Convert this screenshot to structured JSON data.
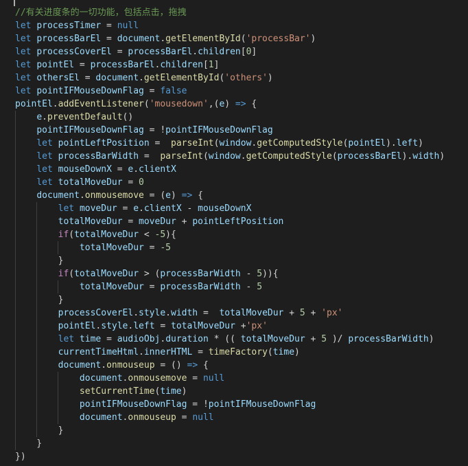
{
  "editor": {
    "theme": "dark",
    "lines": [
      [
        {
          "t": "//有关进度条的一切功能，包括点击，拖拽",
          "c": "cmt"
        }
      ],
      [
        {
          "t": "let ",
          "c": "kw"
        },
        {
          "t": "processTimer",
          "c": "var"
        },
        {
          "t": " = ",
          "c": "op"
        },
        {
          "t": "null",
          "c": "kw"
        }
      ],
      [
        {
          "t": "let ",
          "c": "kw"
        },
        {
          "t": "processBarEl",
          "c": "var"
        },
        {
          "t": " = ",
          "c": "op"
        },
        {
          "t": "document",
          "c": "var"
        },
        {
          "t": ".",
          "c": "op"
        },
        {
          "t": "getElementById",
          "c": "fn"
        },
        {
          "t": "(",
          "c": "op"
        },
        {
          "t": "'processBar'",
          "c": "str"
        },
        {
          "t": ")",
          "c": "op"
        }
      ],
      [
        {
          "t": "let ",
          "c": "kw"
        },
        {
          "t": "processCoverEl",
          "c": "var"
        },
        {
          "t": " = ",
          "c": "op"
        },
        {
          "t": "processBarEl",
          "c": "var"
        },
        {
          "t": ".",
          "c": "op"
        },
        {
          "t": "children",
          "c": "var"
        },
        {
          "t": "[",
          "c": "op"
        },
        {
          "t": "0",
          "c": "num"
        },
        {
          "t": "]",
          "c": "op"
        }
      ],
      [
        {
          "t": "let ",
          "c": "kw"
        },
        {
          "t": "pointEl",
          "c": "var"
        },
        {
          "t": " = ",
          "c": "op"
        },
        {
          "t": "processBarEl",
          "c": "var"
        },
        {
          "t": ".",
          "c": "op"
        },
        {
          "t": "children",
          "c": "var"
        },
        {
          "t": "[",
          "c": "op"
        },
        {
          "t": "1",
          "c": "num"
        },
        {
          "t": "]",
          "c": "op"
        }
      ],
      [
        {
          "t": "let ",
          "c": "kw"
        },
        {
          "t": "othersEl",
          "c": "var"
        },
        {
          "t": " = ",
          "c": "op"
        },
        {
          "t": "document",
          "c": "var"
        },
        {
          "t": ".",
          "c": "op"
        },
        {
          "t": "getElementById",
          "c": "fn"
        },
        {
          "t": "(",
          "c": "op"
        },
        {
          "t": "'others'",
          "c": "str"
        },
        {
          "t": ")",
          "c": "op"
        }
      ],
      [
        {
          "t": "let ",
          "c": "kw"
        },
        {
          "t": "pointIFMouseDownFlag",
          "c": "var"
        },
        {
          "t": " = ",
          "c": "op"
        },
        {
          "t": "false",
          "c": "kw"
        }
      ],
      [
        {
          "t": "pointEl",
          "c": "var"
        },
        {
          "t": ".",
          "c": "op"
        },
        {
          "t": "addEventListener",
          "c": "fn"
        },
        {
          "t": "(",
          "c": "op"
        },
        {
          "t": "'mousedown'",
          "c": "str"
        },
        {
          "t": ",(",
          "c": "op"
        },
        {
          "t": "e",
          "c": "var"
        },
        {
          "t": ") ",
          "c": "op"
        },
        {
          "t": "=>",
          "c": "kw"
        },
        {
          "t": " {",
          "c": "op"
        }
      ],
      [
        {
          "t": "    ",
          "c": "op"
        },
        {
          "t": "e",
          "c": "var"
        },
        {
          "t": ".",
          "c": "op"
        },
        {
          "t": "preventDefault",
          "c": "fn"
        },
        {
          "t": "()",
          "c": "op"
        }
      ],
      [
        {
          "t": "    ",
          "c": "op"
        },
        {
          "t": "pointIFMouseDownFlag",
          "c": "var"
        },
        {
          "t": " = !",
          "c": "op"
        },
        {
          "t": "pointIFMouseDownFlag",
          "c": "var"
        }
      ],
      [
        {
          "t": "    ",
          "c": "op"
        },
        {
          "t": "let ",
          "c": "kw"
        },
        {
          "t": "pointLeftPosition",
          "c": "var"
        },
        {
          "t": " =  ",
          "c": "op"
        },
        {
          "t": "parseInt",
          "c": "fn"
        },
        {
          "t": "(",
          "c": "op"
        },
        {
          "t": "window",
          "c": "var"
        },
        {
          "t": ".",
          "c": "op"
        },
        {
          "t": "getComputedStyle",
          "c": "fn"
        },
        {
          "t": "(",
          "c": "op"
        },
        {
          "t": "pointEl",
          "c": "var"
        },
        {
          "t": ").",
          "c": "op"
        },
        {
          "t": "left",
          "c": "var"
        },
        {
          "t": ")",
          "c": "op"
        }
      ],
      [
        {
          "t": "    ",
          "c": "op"
        },
        {
          "t": "let ",
          "c": "kw"
        },
        {
          "t": "processBarWidth",
          "c": "var"
        },
        {
          "t": " =  ",
          "c": "op"
        },
        {
          "t": "parseInt",
          "c": "fn"
        },
        {
          "t": "(",
          "c": "op"
        },
        {
          "t": "window",
          "c": "var"
        },
        {
          "t": ".",
          "c": "op"
        },
        {
          "t": "getComputedStyle",
          "c": "fn"
        },
        {
          "t": "(",
          "c": "op"
        },
        {
          "t": "processBarEl",
          "c": "var"
        },
        {
          "t": ").",
          "c": "op"
        },
        {
          "t": "width",
          "c": "var"
        },
        {
          "t": ")",
          "c": "op"
        }
      ],
      [
        {
          "t": "    ",
          "c": "op"
        },
        {
          "t": "let ",
          "c": "kw"
        },
        {
          "t": "mouseDownX",
          "c": "var"
        },
        {
          "t": " = ",
          "c": "op"
        },
        {
          "t": "e",
          "c": "var"
        },
        {
          "t": ".",
          "c": "op"
        },
        {
          "t": "clientX",
          "c": "var"
        }
      ],
      [
        {
          "t": "    ",
          "c": "op"
        },
        {
          "t": "let ",
          "c": "kw"
        },
        {
          "t": "totalMoveDur",
          "c": "var"
        },
        {
          "t": " = ",
          "c": "op"
        },
        {
          "t": "0",
          "c": "num"
        }
      ],
      [
        {
          "t": "    ",
          "c": "op"
        },
        {
          "t": "document",
          "c": "var"
        },
        {
          "t": ".",
          "c": "op"
        },
        {
          "t": "onmousemove",
          "c": "fn"
        },
        {
          "t": " = (",
          "c": "op"
        },
        {
          "t": "e",
          "c": "var"
        },
        {
          "t": ") ",
          "c": "op"
        },
        {
          "t": "=>",
          "c": "kw"
        },
        {
          "t": " {",
          "c": "op"
        }
      ],
      [
        {
          "t": "        ",
          "c": "op"
        },
        {
          "t": "let ",
          "c": "kw"
        },
        {
          "t": "moveDur",
          "c": "var"
        },
        {
          "t": " = ",
          "c": "op"
        },
        {
          "t": "e",
          "c": "var"
        },
        {
          "t": ".",
          "c": "op"
        },
        {
          "t": "clientX",
          "c": "var"
        },
        {
          "t": " - ",
          "c": "op"
        },
        {
          "t": "mouseDownX",
          "c": "var"
        }
      ],
      [
        {
          "t": "        ",
          "c": "op"
        },
        {
          "t": "totalMoveDur",
          "c": "var"
        },
        {
          "t": " = ",
          "c": "op"
        },
        {
          "t": "moveDur",
          "c": "var"
        },
        {
          "t": " + ",
          "c": "op"
        },
        {
          "t": "pointLeftPosition",
          "c": "var"
        }
      ],
      [
        {
          "t": "        ",
          "c": "op"
        },
        {
          "t": "if",
          "c": "ctl"
        },
        {
          "t": "(",
          "c": "op"
        },
        {
          "t": "totalMoveDur",
          "c": "var"
        },
        {
          "t": " < ",
          "c": "op"
        },
        {
          "t": "-5",
          "c": "num"
        },
        {
          "t": "){",
          "c": "op"
        }
      ],
      [
        {
          "t": "            ",
          "c": "op"
        },
        {
          "t": "totalMoveDur",
          "c": "var"
        },
        {
          "t": " = ",
          "c": "op"
        },
        {
          "t": "-5",
          "c": "num"
        }
      ],
      [
        {
          "t": "        }",
          "c": "op"
        }
      ],
      [
        {
          "t": "        ",
          "c": "op"
        },
        {
          "t": "if",
          "c": "ctl"
        },
        {
          "t": "(",
          "c": "op"
        },
        {
          "t": "totalMoveDur",
          "c": "var"
        },
        {
          "t": " > (",
          "c": "op"
        },
        {
          "t": "processBarWidth",
          "c": "var"
        },
        {
          "t": " - ",
          "c": "op"
        },
        {
          "t": "5",
          "c": "num"
        },
        {
          "t": ")){",
          "c": "op"
        }
      ],
      [
        {
          "t": "            ",
          "c": "op"
        },
        {
          "t": "totalMoveDur",
          "c": "var"
        },
        {
          "t": " = ",
          "c": "op"
        },
        {
          "t": "processBarWidth",
          "c": "var"
        },
        {
          "t": " - ",
          "c": "op"
        },
        {
          "t": "5",
          "c": "num"
        }
      ],
      [
        {
          "t": "        }",
          "c": "op"
        }
      ],
      [
        {
          "t": "        ",
          "c": "op"
        },
        {
          "t": "processCoverEl",
          "c": "var"
        },
        {
          "t": ".",
          "c": "op"
        },
        {
          "t": "style",
          "c": "var"
        },
        {
          "t": ".",
          "c": "op"
        },
        {
          "t": "width",
          "c": "var"
        },
        {
          "t": " =  ",
          "c": "op"
        },
        {
          "t": "totalMoveDur",
          "c": "var"
        },
        {
          "t": " + ",
          "c": "op"
        },
        {
          "t": "5",
          "c": "num"
        },
        {
          "t": " + ",
          "c": "op"
        },
        {
          "t": "'px'",
          "c": "str"
        }
      ],
      [
        {
          "t": "        ",
          "c": "op"
        },
        {
          "t": "pointEl",
          "c": "var"
        },
        {
          "t": ".",
          "c": "op"
        },
        {
          "t": "style",
          "c": "var"
        },
        {
          "t": ".",
          "c": "op"
        },
        {
          "t": "left",
          "c": "var"
        },
        {
          "t": " = ",
          "c": "op"
        },
        {
          "t": "totalMoveDur",
          "c": "var"
        },
        {
          "t": " +",
          "c": "op"
        },
        {
          "t": "'px'",
          "c": "str"
        }
      ],
      [
        {
          "t": "        ",
          "c": "op"
        },
        {
          "t": "let ",
          "c": "kw"
        },
        {
          "t": "time",
          "c": "var"
        },
        {
          "t": " = ",
          "c": "op"
        },
        {
          "t": "audioObj",
          "c": "var"
        },
        {
          "t": ".",
          "c": "op"
        },
        {
          "t": "duration",
          "c": "var"
        },
        {
          "t": " * (( ",
          "c": "op"
        },
        {
          "t": "totalMoveDur",
          "c": "var"
        },
        {
          "t": " + ",
          "c": "op"
        },
        {
          "t": "5",
          "c": "num"
        },
        {
          "t": " )/ ",
          "c": "op"
        },
        {
          "t": "processBarWidth",
          "c": "var"
        },
        {
          "t": ")",
          "c": "op"
        }
      ],
      [
        {
          "t": "        ",
          "c": "op"
        },
        {
          "t": "currentTimeHtml",
          "c": "var"
        },
        {
          "t": ".",
          "c": "op"
        },
        {
          "t": "innerHTML",
          "c": "var"
        },
        {
          "t": " = ",
          "c": "op"
        },
        {
          "t": "timeFactory",
          "c": "fn"
        },
        {
          "t": "(",
          "c": "op"
        },
        {
          "t": "time",
          "c": "var"
        },
        {
          "t": ")",
          "c": "op"
        }
      ],
      [
        {
          "t": "        ",
          "c": "op"
        },
        {
          "t": "document",
          "c": "var"
        },
        {
          "t": ".",
          "c": "op"
        },
        {
          "t": "onmouseup",
          "c": "fn"
        },
        {
          "t": " = () ",
          "c": "op"
        },
        {
          "t": "=>",
          "c": "kw"
        },
        {
          "t": " {",
          "c": "op"
        }
      ],
      [
        {
          "t": "            ",
          "c": "op"
        },
        {
          "t": "document",
          "c": "var"
        },
        {
          "t": ".",
          "c": "op"
        },
        {
          "t": "onmousemove",
          "c": "fn"
        },
        {
          "t": " = ",
          "c": "op"
        },
        {
          "t": "null",
          "c": "kw"
        }
      ],
      [
        {
          "t": "            ",
          "c": "op"
        },
        {
          "t": "setCurrentTime",
          "c": "fn"
        },
        {
          "t": "(",
          "c": "op"
        },
        {
          "t": "time",
          "c": "var"
        },
        {
          "t": ")",
          "c": "op"
        }
      ],
      [
        {
          "t": "            ",
          "c": "op"
        },
        {
          "t": "pointIFMouseDownFlag",
          "c": "var"
        },
        {
          "t": " = !",
          "c": "op"
        },
        {
          "t": "pointIFMouseDownFlag",
          "c": "var"
        }
      ],
      [
        {
          "t": "            ",
          "c": "op"
        },
        {
          "t": "document",
          "c": "var"
        },
        {
          "t": ".",
          "c": "op"
        },
        {
          "t": "onmouseup",
          "c": "fn"
        },
        {
          "t": " = ",
          "c": "op"
        },
        {
          "t": "null",
          "c": "kw"
        }
      ],
      [
        {
          "t": "        }",
          "c": "op"
        }
      ],
      [
        {
          "t": "    }",
          "c": "op"
        }
      ],
      [
        {
          "t": "})",
          "c": "op"
        }
      ]
    ]
  }
}
